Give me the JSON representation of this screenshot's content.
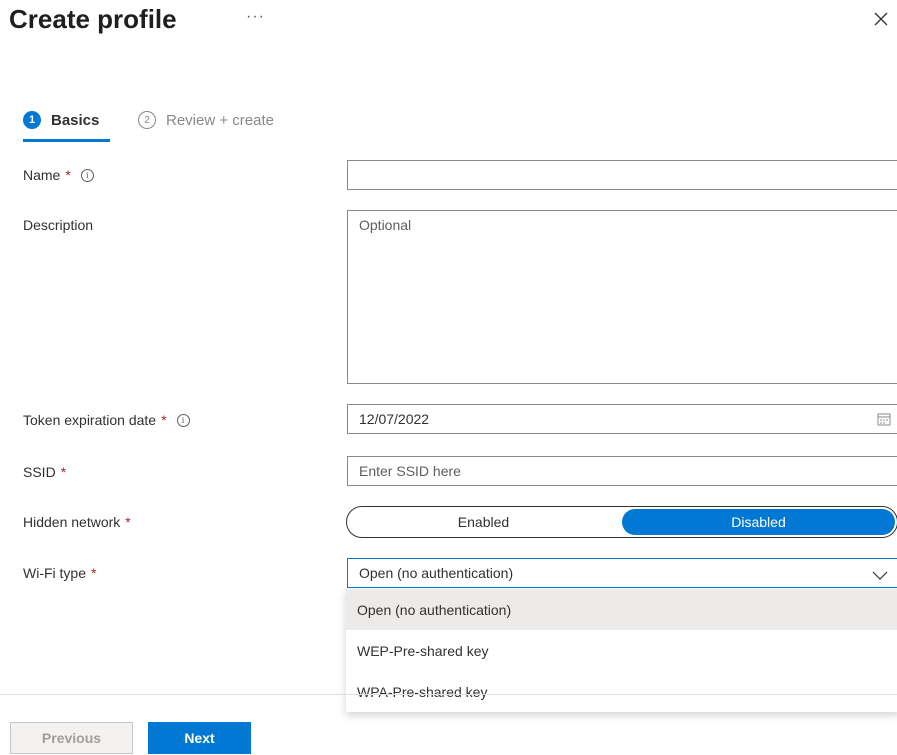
{
  "header": {
    "title": "Create profile",
    "more": "···"
  },
  "steps": [
    {
      "number": "1",
      "label": "Basics"
    },
    {
      "number": "2",
      "label": "Review + create"
    }
  ],
  "form": {
    "name": {
      "label": "Name",
      "required": "*",
      "info": "i",
      "value": ""
    },
    "description": {
      "label": "Description",
      "placeholder": "Optional"
    },
    "token_expiration": {
      "label": "Token expiration date",
      "required": "*",
      "info": "i",
      "value": "12/07/2022"
    },
    "ssid": {
      "label": "SSID",
      "required": "*",
      "placeholder": "Enter SSID here"
    },
    "hidden_network": {
      "label": "Hidden network",
      "required": "*",
      "options": [
        "Enabled",
        "Disabled"
      ],
      "selected": "Disabled"
    },
    "wifi_type": {
      "label": "Wi-Fi type",
      "required": "*",
      "value": "Open (no authentication)",
      "options": [
        "Open (no authentication)",
        "WEP-Pre-shared key",
        "WPA-Pre-shared key"
      ]
    }
  },
  "footer": {
    "previous": "Previous",
    "next": "Next"
  },
  "colors": {
    "accent": "#0078d4",
    "required": "#a4262c",
    "text": "#323130"
  }
}
